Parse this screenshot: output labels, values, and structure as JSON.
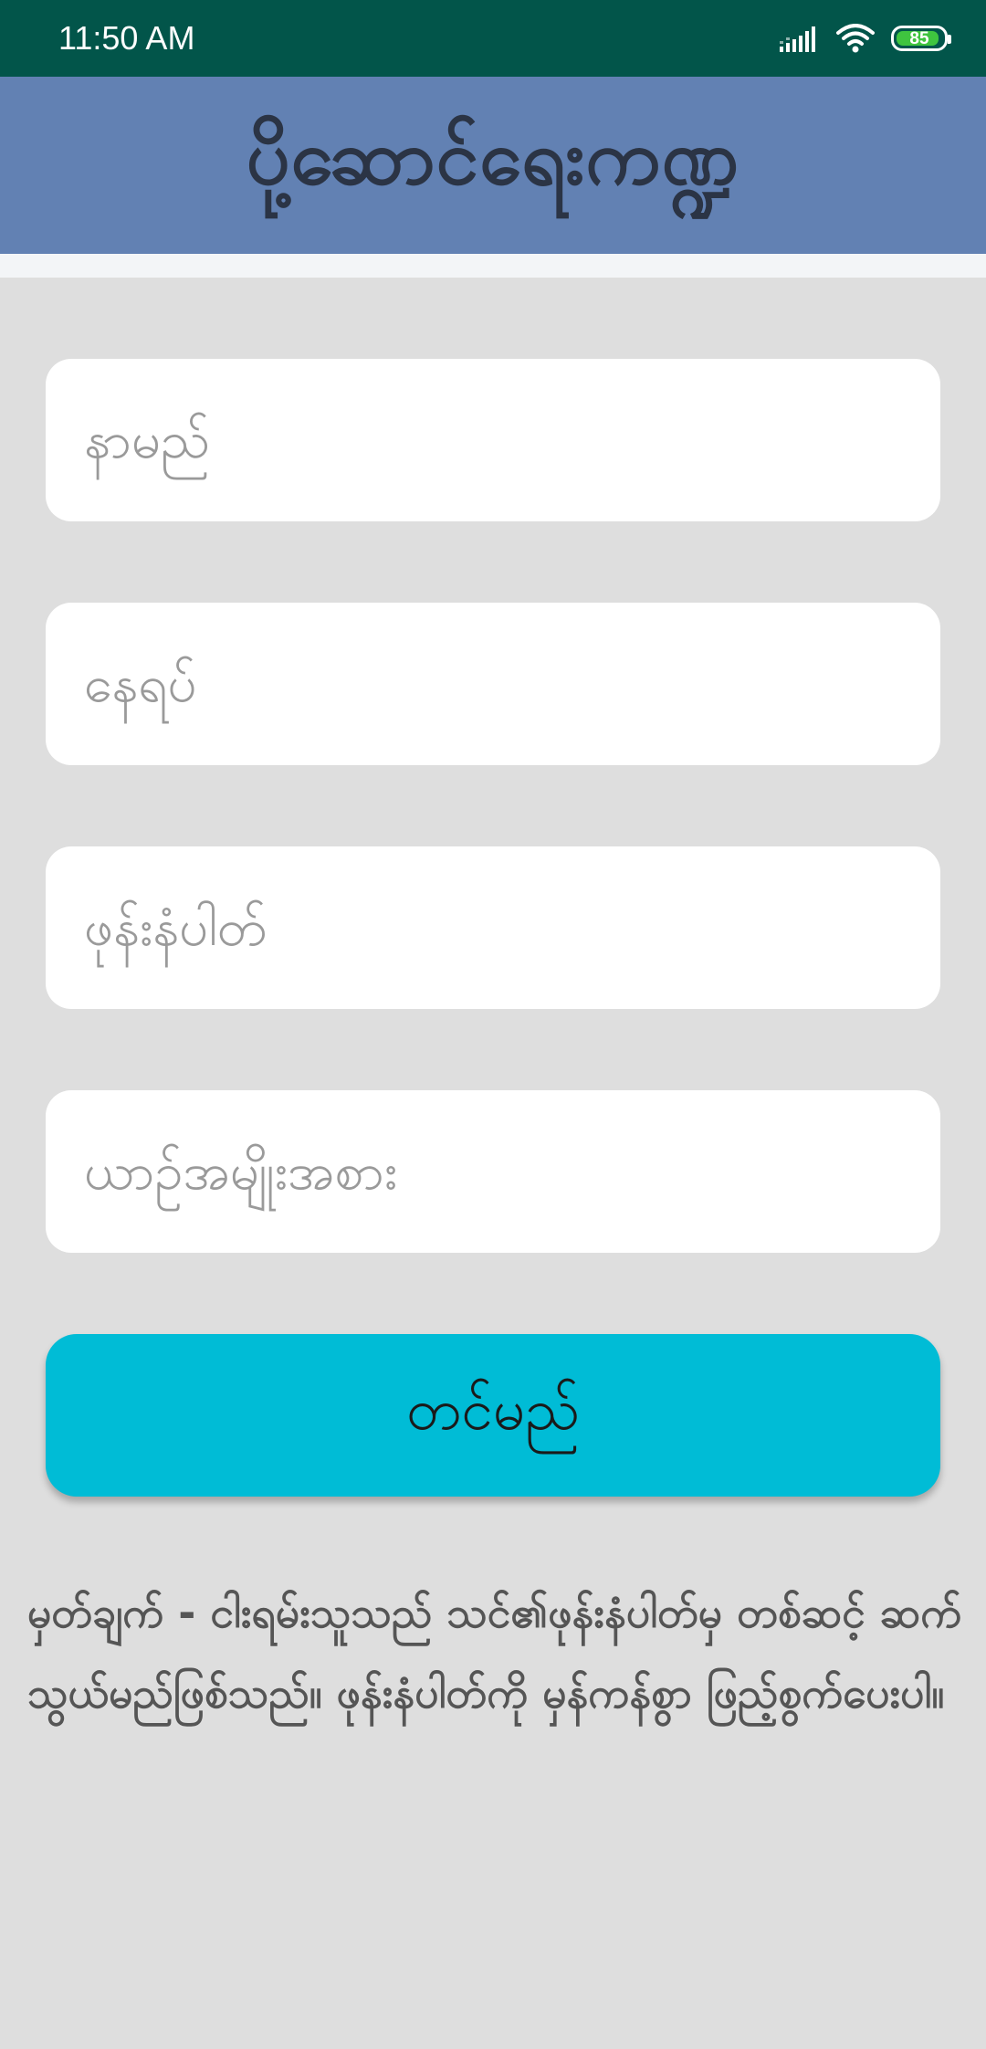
{
  "status_bar": {
    "time": "11:50 AM",
    "battery": "85",
    "icons": [
      "signal-icon",
      "wifi-icon",
      "battery-icon"
    ]
  },
  "header": {
    "title": "ပို့ဆောင်ရေးကဏ္ဍ"
  },
  "form": {
    "name_placeholder": "နာမည်",
    "address_placeholder": "နေရပ်",
    "phone_placeholder": "ဖုန်းနံပါတ်",
    "vehicle_placeholder": "ယာဥ်အမျိုးအစား",
    "submit_label": "တင်မည်"
  },
  "note": "မှတ်ချက်  -  ငါးရမ်းသူသည် သင်၏ဖုန်းနံပါတ်မှ တစ်ဆင့် ဆက်သွယ်မည်ဖြစ်သည်။ ဖုန်းနံပါတ်ကို မှန်ကန်စွာ ဖြည့်စွက်ပေးပါ။",
  "colors": {
    "status_bar": "#02554a",
    "header": "#6281b3",
    "background": "#dedede",
    "button": "#00bcd6"
  }
}
